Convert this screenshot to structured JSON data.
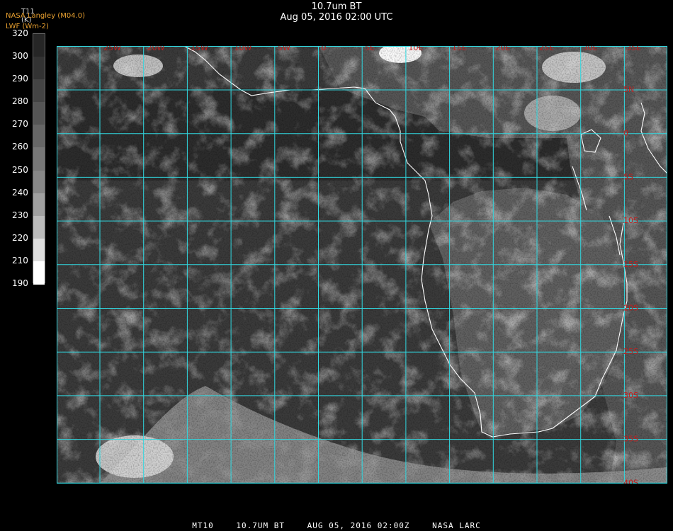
{
  "header": {
    "title": "10.7um BT",
    "datetime": "Aug 05, 2016 02:00 UTC"
  },
  "credits": {
    "line1": "NASA Langley (M04.0)",
    "line2": "LWF (Wm-2)"
  },
  "colorbar": {
    "unit_top": "T11",
    "unit_bottom": "(K)",
    "ticks": [
      "320",
      "300",
      "290",
      "280",
      "270",
      "260",
      "250",
      "240",
      "230",
      "220",
      "210",
      "190"
    ],
    "colors": [
      "#161616",
      "#262626",
      "#333333",
      "#444444",
      "#555555",
      "#666666",
      "#777777",
      "#888888",
      "#a0a0a0",
      "#bbbbbb",
      "#dddddd",
      "#ffffff"
    ]
  },
  "map": {
    "grid_color": "#30d8e0",
    "label_color": "#c02020",
    "coast_color": "#ffffff",
    "lon_labels": [
      "25W",
      "20W",
      "15W",
      "10W",
      "5W",
      "0",
      "5E",
      "10E",
      "15E",
      "20E",
      "25E",
      "30E",
      "35E"
    ],
    "lat_labels": [
      "5N",
      "0",
      "5S",
      "10S",
      "15S",
      "20S",
      "25S",
      "30S",
      "35S",
      "40S"
    ]
  },
  "footer": {
    "satellite": "MT10",
    "product": "10.7UM BT",
    "date": "AUG 05, 2016 02:00Z",
    "source": "NASA LARC"
  }
}
